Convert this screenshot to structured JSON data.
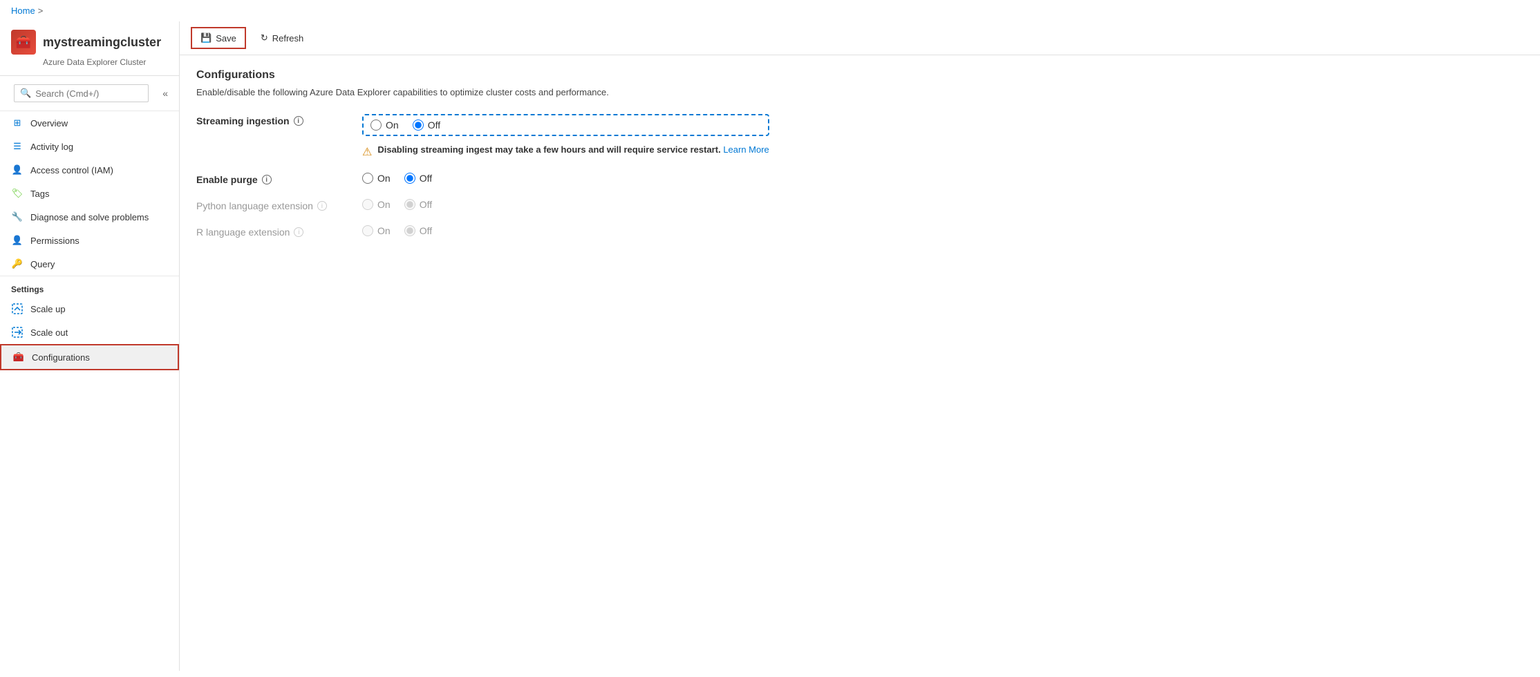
{
  "breadcrumb": {
    "home_label": "Home",
    "separator": ">"
  },
  "header": {
    "cluster_name": "mystreamingcluster",
    "separator": "|",
    "page_title": "Configurations",
    "subtitle": "Azure Data Explorer Cluster",
    "icon": "🧰"
  },
  "sidebar": {
    "search_placeholder": "Search (Cmd+/)",
    "collapse_icon": "«",
    "nav_items": [
      {
        "id": "overview",
        "label": "Overview",
        "icon": "grid"
      },
      {
        "id": "activity-log",
        "label": "Activity log",
        "icon": "list"
      },
      {
        "id": "access-control",
        "label": "Access control (IAM)",
        "icon": "people"
      },
      {
        "id": "tags",
        "label": "Tags",
        "icon": "tag"
      },
      {
        "id": "diagnose",
        "label": "Diagnose and solve problems",
        "icon": "wrench"
      },
      {
        "id": "permissions",
        "label": "Permissions",
        "icon": "person-gear"
      },
      {
        "id": "query",
        "label": "Query",
        "icon": "key"
      }
    ],
    "settings_label": "Settings",
    "settings_items": [
      {
        "id": "scale-up",
        "label": "Scale up",
        "icon": "scale-up"
      },
      {
        "id": "scale-out",
        "label": "Scale out",
        "icon": "scale-out"
      },
      {
        "id": "configurations",
        "label": "Configurations",
        "icon": "configurations",
        "active": true
      }
    ]
  },
  "toolbar": {
    "save_label": "Save",
    "refresh_label": "Refresh",
    "save_icon": "💾",
    "refresh_icon": "↻"
  },
  "main": {
    "section_title": "Configurations",
    "section_desc": "Enable/disable the following Azure Data Explorer capabilities to optimize cluster costs and performance.",
    "rows": [
      {
        "id": "streaming-ingestion",
        "label": "Streaming ingestion",
        "info": true,
        "highlighted": true,
        "on_selected": false,
        "off_selected": true,
        "disabled": false,
        "warning": true,
        "warning_text": "Disabling streaming ingest may take a few hours and will require service restart.",
        "learn_more_label": "Learn More",
        "learn_more_url": "#"
      },
      {
        "id": "enable-purge",
        "label": "Enable purge",
        "info": true,
        "highlighted": false,
        "on_selected": false,
        "off_selected": true,
        "disabled": false,
        "warning": false
      },
      {
        "id": "python-language",
        "label": "Python language extension",
        "info": true,
        "highlighted": false,
        "on_selected": false,
        "off_selected": true,
        "disabled": true,
        "warning": false
      },
      {
        "id": "r-language",
        "label": "R language extension",
        "info": true,
        "highlighted": false,
        "on_selected": false,
        "off_selected": true,
        "disabled": true,
        "warning": false
      }
    ],
    "on_label": "On",
    "off_label": "Off"
  }
}
